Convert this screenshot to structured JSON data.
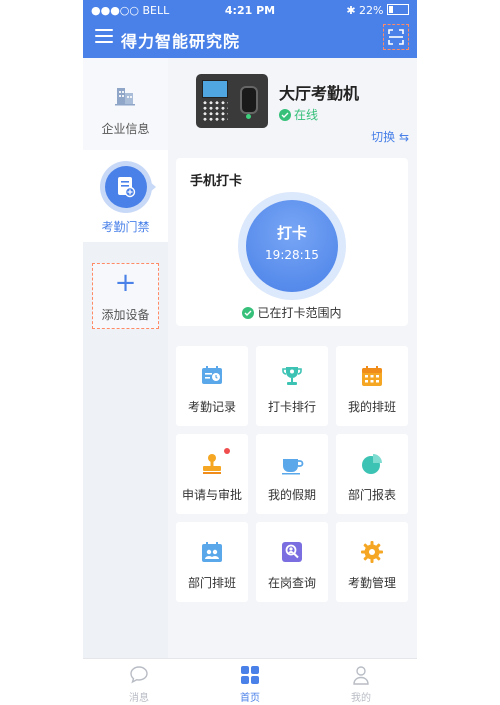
{
  "status": {
    "carrier": "●●●○○ BELL",
    "time": "4:21 PM",
    "battery": "22%"
  },
  "nav": {
    "title": "得力智能研究院"
  },
  "sidebar": {
    "company_label": "企业信息",
    "attend_label": "考勤门禁",
    "add_label": "添加设备",
    "add_symbol": "+"
  },
  "device": {
    "name": "大厅考勤机",
    "status": "在线",
    "switch_label": "切换 ⇆"
  },
  "clock": {
    "title": "手机打卡",
    "button_label": "打卡",
    "time": "19:28:15",
    "range_text": "已在打卡范围内"
  },
  "grid": [
    {
      "label": "考勤记录",
      "icon": "attendance-record-icon"
    },
    {
      "label": "打卡排行",
      "icon": "trophy-icon"
    },
    {
      "label": "我的排班",
      "icon": "calendar-icon"
    },
    {
      "label": "申请与审批",
      "icon": "stamp-icon",
      "badge": true
    },
    {
      "label": "我的假期",
      "icon": "cup-icon"
    },
    {
      "label": "部门报表",
      "icon": "pie-chart-icon"
    },
    {
      "label": "部门排班",
      "icon": "team-calendar-icon"
    },
    {
      "label": "在岗查询",
      "icon": "on-duty-search-icon"
    },
    {
      "label": "考勤管理",
      "icon": "settings-gear-icon"
    }
  ],
  "tabs": [
    {
      "label": "消息",
      "active": false
    },
    {
      "label": "首页",
      "active": true
    },
    {
      "label": "我的",
      "active": false
    }
  ],
  "colors": {
    "primary": "#4a81e8",
    "success": "#36c07a",
    "orange": "#f5a623",
    "muted": "#b8bcc4"
  }
}
